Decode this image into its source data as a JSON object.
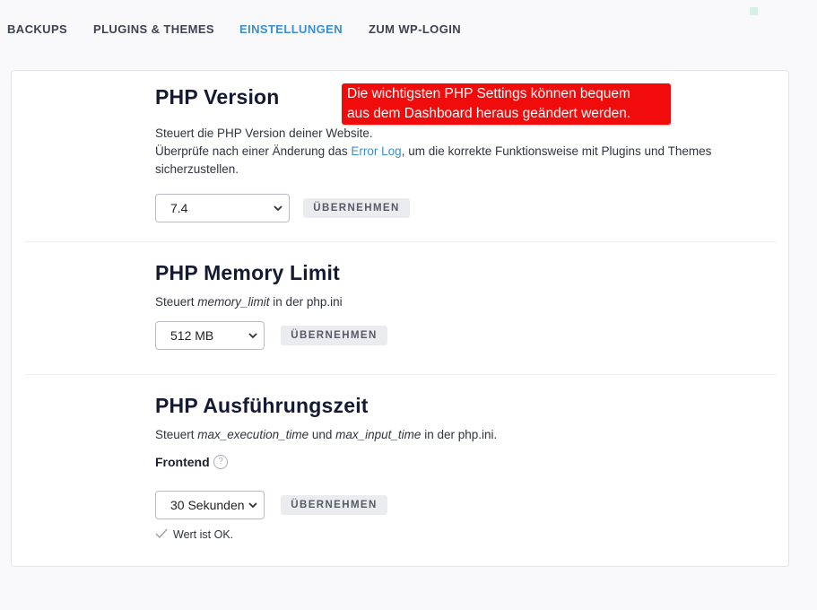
{
  "nav": {
    "tabs": [
      {
        "label": "BACKUPS"
      },
      {
        "label": "PLUGINS & THEMES"
      },
      {
        "label": "EINSTELLUNGEN"
      },
      {
        "label": "ZUM WP-LOGIN"
      }
    ],
    "active_tab": "EINSTELLUNGEN",
    "active_color": "#3b8fd0"
  },
  "callout": {
    "line1": "Die wichtigsten PHP Settings können bequem",
    "line2": "aus dem Dashboard heraus geändert werden.",
    "color": "#f20b0b"
  },
  "php_version": {
    "title": "PHP Version",
    "desc_line1": "Steuert die PHP Version deiner Website.",
    "desc_line2_prefix": "Überprüfe nach einer Änderung das ",
    "desc_link": "Error Log",
    "desc_line2_suffix": ", um die korrekte Funktionsweise mit Plugins und Themes sicherzustellen.",
    "selected": "7.4",
    "apply_label": "ÜBERNEHMEN"
  },
  "memory_limit": {
    "title": "PHP Memory Limit",
    "desc_prefix": "Steuert ",
    "desc_code": "memory_limit",
    "desc_suffix": " in der php.ini",
    "selected": "512 MB",
    "apply_label": "ÜBERNEHMEN"
  },
  "execution_time": {
    "title": "PHP Ausführungszeit",
    "desc_prefix": "Steuert ",
    "desc_code1": "max_execution_time",
    "desc_mid": " und ",
    "desc_code2": "max_input_time",
    "desc_suffix": " in der php.ini.",
    "frontend_label": "Frontend",
    "help_icon": "question-circle-icon",
    "selected": "30 Sekunden",
    "apply_label": "ÜBERNEHMEN",
    "status_icon": "check-icon",
    "status_text": "Wert ist OK."
  }
}
